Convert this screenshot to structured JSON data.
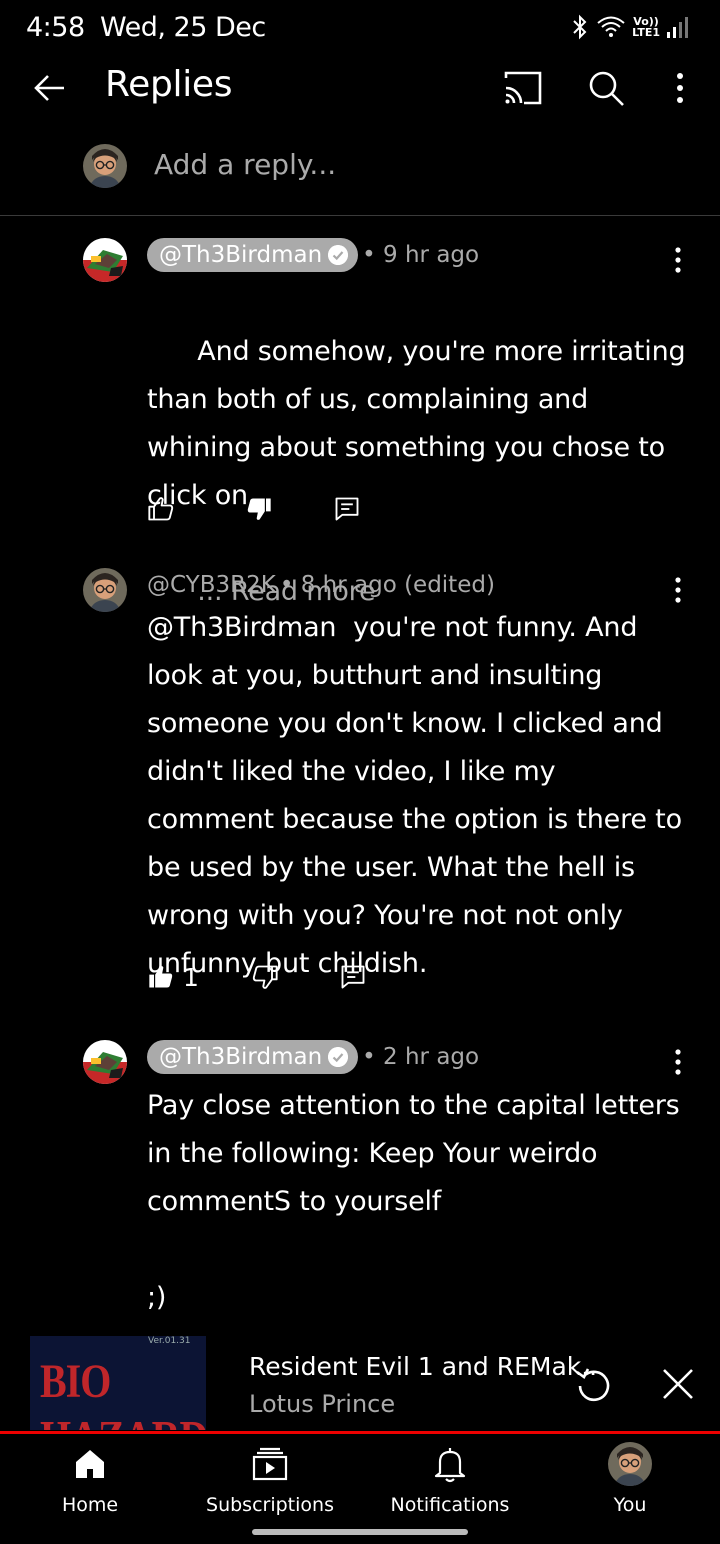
{
  "status_bar": {
    "time": "4:58",
    "date": "Wed, 25 Dec",
    "icons": [
      "bluetooth-icon",
      "wifi-icon",
      "volte-icon",
      "signal-icon"
    ],
    "volte_label_top": "Vo))",
    "volte_label_bottom": "LTE1"
  },
  "app_bar": {
    "title": "Replies",
    "icons": [
      "back-arrow-icon",
      "cast-icon",
      "search-icon",
      "more-vert-icon"
    ]
  },
  "add_reply": {
    "placeholder": "Add a reply..."
  },
  "comments": [
    {
      "author": "@Th3Birdman",
      "verified_chip": true,
      "meta": "• 9 hr ago",
      "text": "And somehow, you're more irritating than both of us, complaining and whining about something you chose to click on.",
      "read_more": "... Read more",
      "likes": "",
      "disliked": true
    },
    {
      "author": "@CYB3R2K",
      "verified_chip": false,
      "meta": "• 8 hr ago (edited)",
      "text": "@Th3Birdman  you're not funny. And look at you, butthurt and insulting someone you don't know. I clicked and didn't liked the video, I like my comment because the option is there to be used by the user. What the hell is wrong with you? You're not not only unfunny but childish.",
      "likes": "1",
      "liked": true
    },
    {
      "author": "@Th3Birdman",
      "verified_chip": true,
      "meta": "• 2 hr ago",
      "text": "Pay close attention to the capital letters in the following: Keep Your weirdo commentS to yourself\n\n;)"
    }
  ],
  "mini_player": {
    "thumbnail_text": "BIO HAZARD",
    "thumbnail_version": "Ver.01.31",
    "title": "Resident Evil 1 and REMak..",
    "channel": "Lotus Prince",
    "progress_color": "#e00000"
  },
  "bottom_nav": {
    "items": [
      {
        "label": "Home",
        "icon": "home-icon"
      },
      {
        "label": "Subscriptions",
        "icon": "subscriptions-icon"
      },
      {
        "label": "Notifications",
        "icon": "bell-icon"
      },
      {
        "label": "You",
        "icon": "avatar"
      }
    ]
  }
}
